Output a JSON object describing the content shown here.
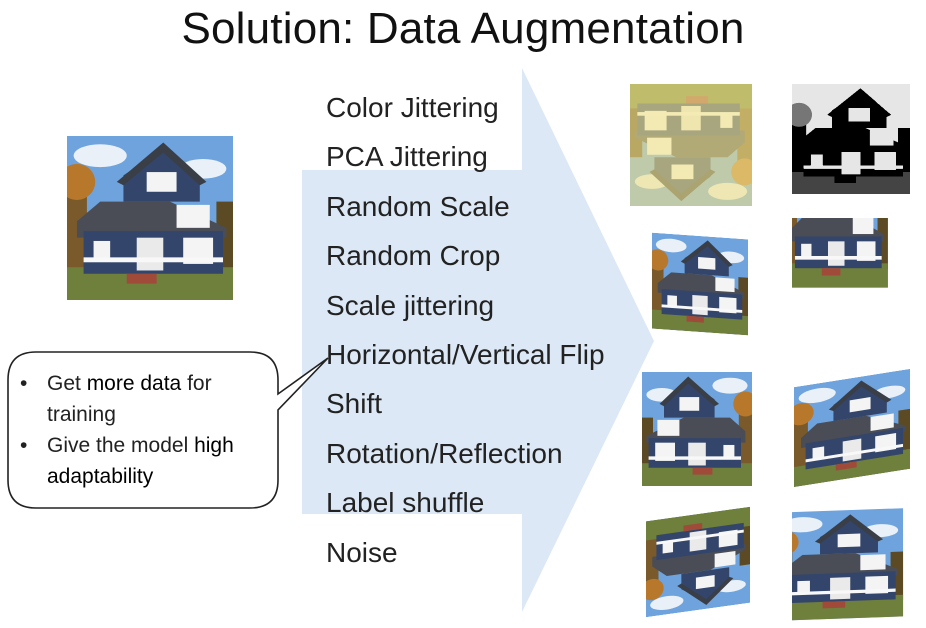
{
  "slide": {
    "title": "Solution: Data Augmentation"
  },
  "methods": [
    "Color Jittering",
    "PCA Jittering",
    "Random Scale",
    "Random Crop",
    "Scale jittering",
    "Horizontal/Vertical Flip",
    "Shift",
    "Rotation/Reflection",
    "Label shuffle",
    "Noise"
  ],
  "bubble": {
    "bullet_1": {
      "pre": "Get ",
      "em": "more data",
      "post": " for training"
    },
    "bullet_2": {
      "pre": "Give the model ",
      "em": "high adaptability"
    }
  },
  "colors": {
    "arrow_fill": "#dce8f5",
    "house_siding": "#33456a",
    "sky": "#6ea3dd",
    "grass": "#6f7f3c",
    "yellow_tint": "#f0e28a"
  },
  "icons": {
    "bullet": "•"
  }
}
